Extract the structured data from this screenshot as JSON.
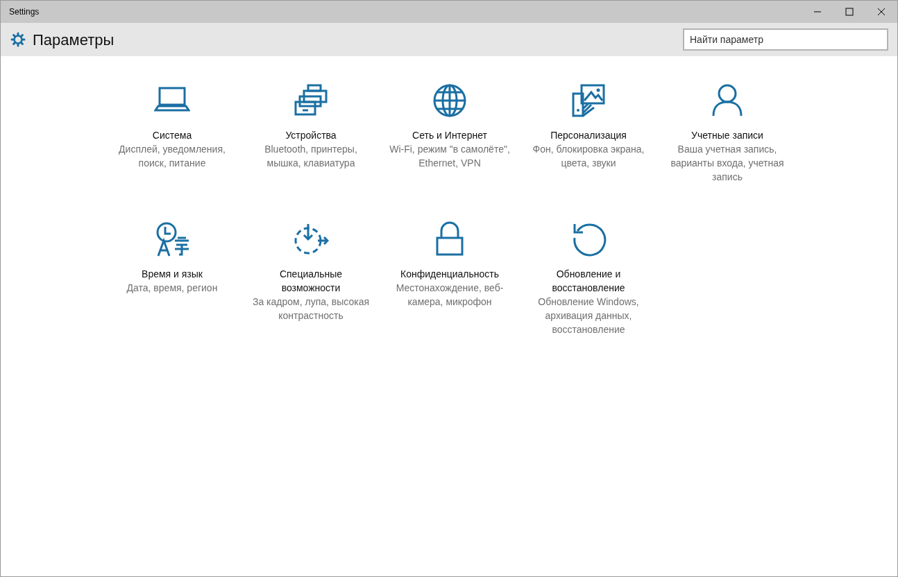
{
  "window": {
    "title": "Settings"
  },
  "header": {
    "title": "Параметры"
  },
  "search": {
    "placeholder": "Найти параметр"
  },
  "categories": [
    {
      "kind": "laptop",
      "title": "Система",
      "description": "Дисплей, уведомления, поиск, питание"
    },
    {
      "kind": "devices",
      "title": "Устройства",
      "description": "Bluetooth, принтеры, мышка, клавиатура"
    },
    {
      "kind": "globe",
      "title": "Сеть и Интернет",
      "description": "Wi-Fi, режим \"в самолёте\", Ethernet, VPN"
    },
    {
      "kind": "personalize",
      "title": "Персонализация",
      "description": "Фон, блокировка экрана, цвета, звуки"
    },
    {
      "kind": "person",
      "title": "Учетные записи",
      "description": "Ваша учетная запись, варианты входа, учетная запись"
    },
    {
      "kind": "time",
      "title": "Время и язык",
      "description": "Дата, время, регион"
    },
    {
      "kind": "access",
      "title": "Специальные возможности",
      "description": "За кадром, лупа, высокая контрастность"
    },
    {
      "kind": "lock",
      "title": "Конфиденциальность",
      "description": "Местонахождение, веб-камера, микрофон"
    },
    {
      "kind": "update",
      "title": "Обновление и восстановление",
      "description": "Обновление Windows, архивация данных, восстановление"
    }
  ]
}
